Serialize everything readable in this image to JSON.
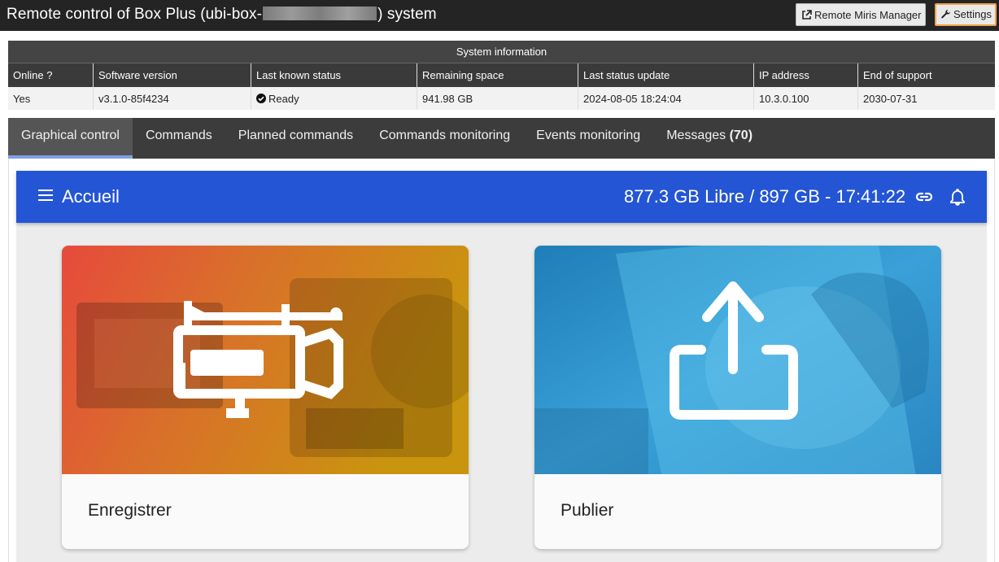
{
  "header": {
    "title_prefix": "Remote control of Box Plus (ubi-box-",
    "title_suffix": ") system",
    "miris_button": "Remote Miris Manager",
    "settings_button": "Settings"
  },
  "system_info": {
    "caption": "System information",
    "columns": [
      "Online ?",
      "Software version",
      "Last known status",
      "Remaining space",
      "Last status update",
      "IP address",
      "End of support"
    ],
    "values": {
      "online": "Yes",
      "software_version": "v3.1.0-85f4234",
      "status": "Ready",
      "remaining_space": "941.98 GB",
      "last_update": "2024-08-05 18:24:04",
      "ip_address": "10.3.0.100",
      "end_of_support": "2030-07-31"
    }
  },
  "tabs": [
    {
      "label": "Graphical control",
      "active": true
    },
    {
      "label": "Commands"
    },
    {
      "label": "Planned commands"
    },
    {
      "label": "Commands monitoring"
    },
    {
      "label": "Events monitoring"
    },
    {
      "label": "Messages",
      "count": "(70)"
    }
  ],
  "app": {
    "title": "Accueil",
    "storage": "877.3 GB Libre / 897 GB - 17:41:22",
    "accent_color": "#2455d4"
  },
  "cards": {
    "record": {
      "label": "Enregistrer",
      "icon": "video-camera-icon"
    },
    "publish": {
      "label": "Publier",
      "icon": "upload-icon"
    }
  }
}
